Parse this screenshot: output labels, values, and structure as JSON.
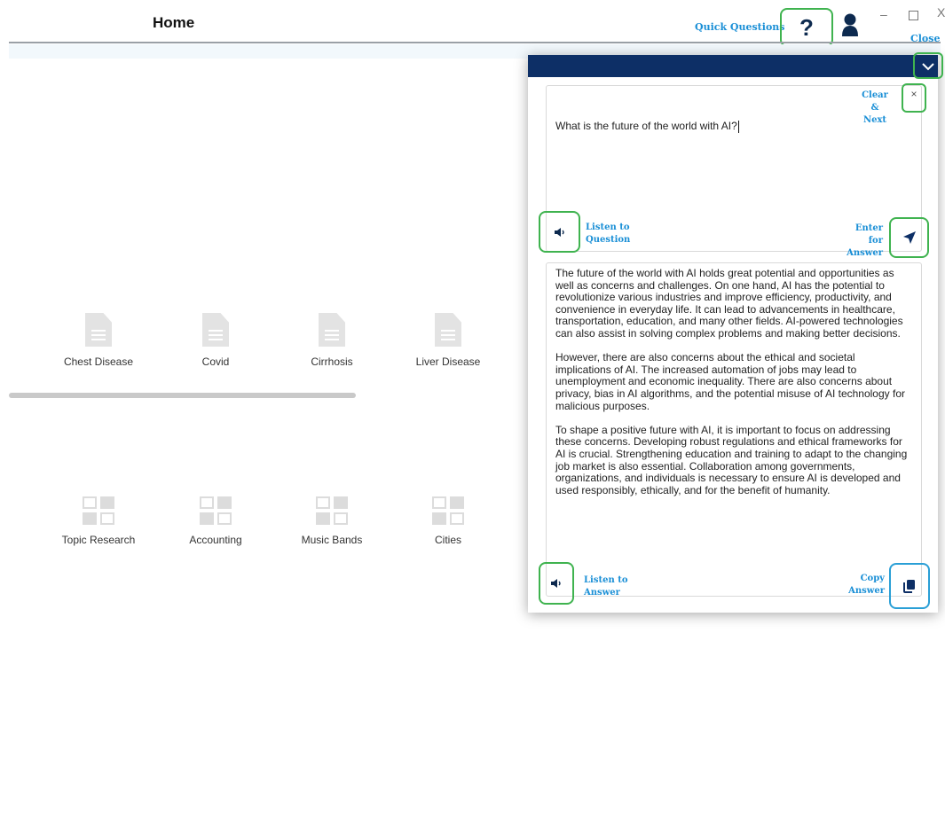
{
  "header": {
    "title": "Home",
    "quick_questions": "Quick Questions",
    "help_glyph": "?",
    "close_label": "Close",
    "window_min": "–",
    "window_close": "X"
  },
  "tiles_row1": [
    {
      "label": "Chest Disease",
      "icon": "document-icon"
    },
    {
      "label": "Covid",
      "icon": "document-icon"
    },
    {
      "label": "Cirrhosis",
      "icon": "document-icon"
    },
    {
      "label": "Liver Disease",
      "icon": "document-icon"
    }
  ],
  "tiles_row2": [
    {
      "label": "Topic Research",
      "icon": "grid-icon"
    },
    {
      "label": "Accounting",
      "icon": "grid-icon"
    },
    {
      "label": "Music Bands",
      "icon": "grid-icon"
    },
    {
      "label": "Cities",
      "icon": "grid-icon"
    }
  ],
  "panel": {
    "question": "What is the future of the world with AI?",
    "clear_next_1": "Clear &",
    "clear_next_2": "Next",
    "clear_x": "×",
    "listen_question_1": "Listen to",
    "listen_question_2": "Question",
    "enter_answer_1": "Enter for",
    "enter_answer_2": "Answer",
    "listen_answer_1": "Listen to",
    "listen_answer_2": "Answer",
    "copy_answer_1": "Copy",
    "copy_answer_2": "Answer",
    "answer_paragraphs": [
      "The future of the world with AI holds great potential and opportunities as well as concerns and challenges. On one hand, AI has the potential to revolutionize various industries and improve efficiency, productivity, and convenience in everyday life. It can lead to advancements in healthcare, transportation, education, and many other fields. AI-powered technologies can also assist in solving complex problems and making better decisions.",
      "However, there are also concerns about the ethical and societal implications of AI. The increased automation of jobs may lead to unemployment and economic inequality. There are also concerns about privacy, bias in AI algorithms, and the potential misuse of AI technology for malicious purposes.",
      "To shape a positive future with AI, it is important to focus on addressing these concerns. Developing robust regulations and ethical frameworks for AI is crucial. Strengthening education and training to adapt to the changing job market is also essential. Collaboration among governments, organizations, and individuals is necessary to ensure AI is developed and used responsibly, ethically, and for the benefit of humanity."
    ]
  },
  "colors": {
    "navy": "#0d2f66",
    "link_blue": "#1a8fd6",
    "highlight_green": "#3fb34f",
    "highlight_blue": "#2a9fd6"
  }
}
